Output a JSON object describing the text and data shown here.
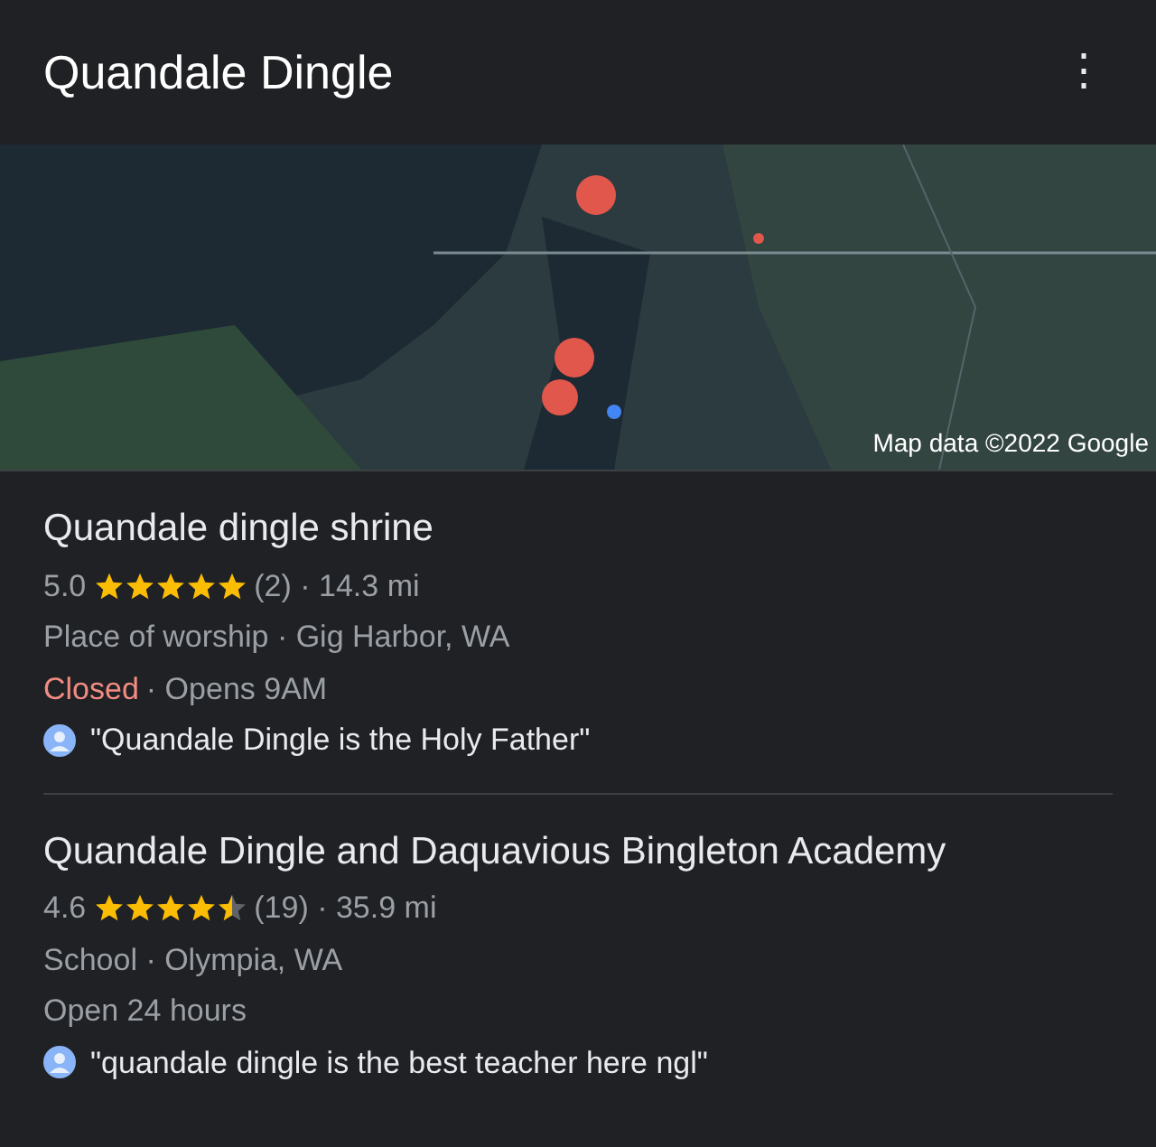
{
  "header": {
    "title": "Quandale Dingle",
    "menu": "⋮"
  },
  "map": {
    "kind": "picture",
    "attribution": "Map data ©2022 Google"
  },
  "results": [
    {
      "name": "Quandale dingle shrine",
      "rating": "5.0",
      "stars": 5,
      "details": "(2) · 14.3 mi",
      "info": "Place of worship · Gig Harbor, WA",
      "status": "Closed",
      "open": false,
      "next": "· Opens 9AM",
      "review": "\"Quandale Dingle is the Holy Father\""
    },
    {
      "name": "Quandale Dingle and Daquavious Bingleton Academy",
      "rating": "4.6",
      "stars": 4.5,
      "details": "(19) · 35.9 mi",
      "info": "School · Olympia, WA",
      "status": "Open 24 hours",
      "open": true,
      "review": "\"quandale dingle is the best teacher here ngl\""
    }
  ]
}
